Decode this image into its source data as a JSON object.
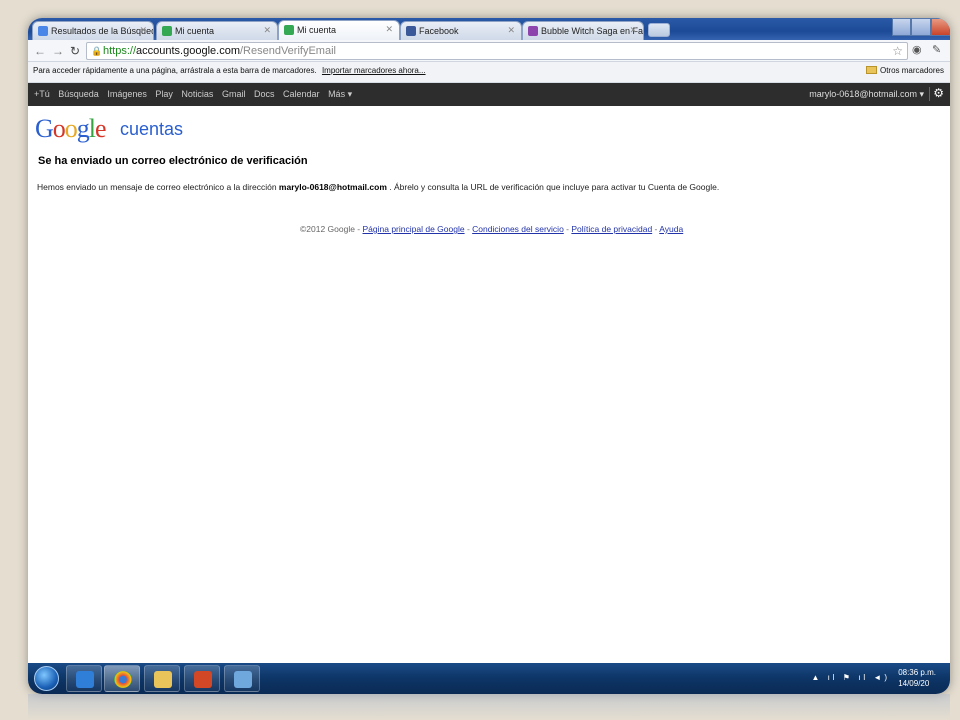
{
  "tabs": [
    {
      "label": "Resultados de la Búsqueda",
      "favicon_color": "#4a86e8"
    },
    {
      "label": "Mi cuenta",
      "favicon_color": "#34a853"
    },
    {
      "label": "Mi cuenta",
      "favicon_color": "#34a853"
    },
    {
      "label": "Facebook",
      "favicon_color": "#3b5998"
    },
    {
      "label": "Bubble Witch Saga en Face",
      "favicon_color": "#8e44ad"
    }
  ],
  "address": {
    "scheme": "https://",
    "host": "accounts.google.com",
    "path": "/ResendVerifyEmail"
  },
  "bookmarks_bar": {
    "hint": "Para acceder rápidamente a una página, arrástrala a esta barra de marcadores.",
    "import_link": "Importar marcadores ahora...",
    "other_bookmarks": "Otros marcadores"
  },
  "google_bar": {
    "items": [
      "+Tú",
      "Búsqueda",
      "Imágenes",
      "Play",
      "Noticias",
      "Gmail",
      "Docs",
      "Calendar",
      "Más ▾"
    ],
    "account": "marylo-0618@hotmail.com ▾"
  },
  "logo": {
    "subtitle": "cuentas"
  },
  "page": {
    "heading": "Se ha enviado un correo electrónico de verificación",
    "msg_before": "Hemos enviado un mensaje de correo electrónico a la dirección ",
    "email": "marylo-0618@hotmail.com",
    "msg_after": " . Ábrelo y consulta la URL de verificación que incluye para activar tu Cuenta de Google."
  },
  "footer": {
    "copyright": "©2012 Google - ",
    "links": [
      "Página principal de Google",
      "Condiciones del servicio",
      "Política de privacidad",
      "Ayuda"
    ],
    "separator": " - "
  },
  "taskbar": {
    "time": "08:36 p.m.",
    "date": "14/09/20"
  },
  "colors": {
    "google_blue": "#2a5fd0",
    "google_bar": "#2d2d2d",
    "link": "#2233aa",
    "taskbar": "#0d3566"
  }
}
